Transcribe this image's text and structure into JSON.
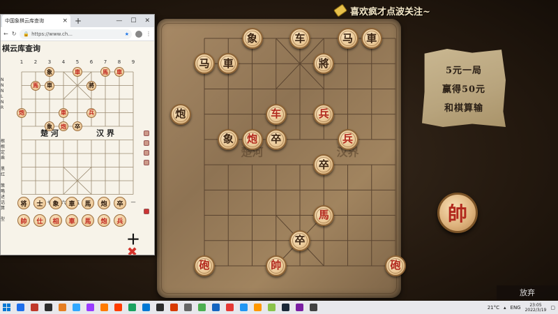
{
  "banner": {
    "text": "喜欢疯才点波关注~"
  },
  "note": {
    "lines": [
      "5元一局",
      "赢得50元",
      "和棋算输"
    ]
  },
  "shuai_big": "帥",
  "give_up_label": "放弃",
  "river": {
    "left": "楚河",
    "right": "汉界"
  },
  "main_pieces": [
    {
      "char": "象",
      "side": "black",
      "col": 2,
      "row": 0
    },
    {
      "char": "车",
      "side": "black",
      "col": 4,
      "row": 0
    },
    {
      "char": "马",
      "side": "black",
      "col": 6,
      "row": 0
    },
    {
      "char": "車",
      "side": "black",
      "col": 7,
      "row": 0
    },
    {
      "char": "马",
      "side": "black",
      "col": 0,
      "row": 1
    },
    {
      "char": "車",
      "side": "black",
      "col": 1,
      "row": 1
    },
    {
      "char": "將",
      "side": "black",
      "col": 5,
      "row": 1
    },
    {
      "char": "炮",
      "side": "black",
      "col": -1,
      "row": 3
    },
    {
      "char": "车",
      "side": "red",
      "col": 3,
      "row": 3
    },
    {
      "char": "兵",
      "side": "red",
      "col": 5,
      "row": 3
    },
    {
      "char": "象",
      "side": "black",
      "col": 1,
      "row": 4
    },
    {
      "char": "炮",
      "side": "red",
      "col": 2,
      "row": 4
    },
    {
      "char": "卒",
      "side": "black",
      "col": 3,
      "row": 4
    },
    {
      "char": "兵",
      "side": "red",
      "col": 6,
      "row": 4
    },
    {
      "char": "卒",
      "side": "black",
      "col": 5,
      "row": 5
    },
    {
      "char": "馬",
      "side": "red",
      "col": 5,
      "row": 7
    },
    {
      "char": "卒",
      "side": "black",
      "col": 4,
      "row": 8
    },
    {
      "char": "砲",
      "side": "red",
      "col": 0,
      "row": 9
    },
    {
      "char": "帥",
      "side": "red",
      "col": 3,
      "row": 9
    },
    {
      "char": "砲",
      "side": "red",
      "col": 8,
      "row": 9
    }
  ],
  "browser": {
    "tab_title": "中国象棋云库查询",
    "url": "https://www.ch...",
    "page_title": "棋云库查询",
    "col_nums_top": [
      "1",
      "2",
      "3",
      "4",
      "5",
      "6",
      "7",
      "8",
      "9"
    ],
    "col_nums_bottom": [
      "九",
      "八",
      "七",
      "六",
      "五",
      "四",
      "三",
      "二",
      "一"
    ],
    "side_labels": [
      "N",
      "N",
      "N",
      "L",
      "N",
      "R",
      "",
      "",
      "",
      "",
      "",
      "根",
      "根",
      "定",
      "乘",
      "",
      "黑",
      "红",
      "",
      "策略",
      "述",
      "话",
      "算",
      "",
      "型"
    ],
    "river": {
      "left": "楚 河",
      "right": "汉 界"
    },
    "mini_pieces": [
      {
        "char": "象",
        "side": "black",
        "col": 2,
        "row": 0
      },
      {
        "char": "車",
        "side": "red",
        "col": 4,
        "row": 0
      },
      {
        "char": "馬",
        "side": "red",
        "col": 6,
        "row": 0
      },
      {
        "char": "車",
        "side": "red",
        "col": 7,
        "row": 0
      },
      {
        "char": "馬",
        "side": "red",
        "col": 1,
        "row": 1
      },
      {
        "char": "車",
        "side": "black",
        "col": 2,
        "row": 1
      },
      {
        "char": "將",
        "side": "black",
        "col": 5,
        "row": 1
      },
      {
        "char": "炮",
        "side": "red",
        "col": 0,
        "row": 3
      },
      {
        "char": "車",
        "side": "red",
        "col": 3,
        "row": 3
      },
      {
        "char": "兵",
        "side": "red",
        "col": 5,
        "row": 3
      },
      {
        "char": "象",
        "side": "black",
        "col": 2,
        "row": 4
      },
      {
        "char": "炮",
        "side": "red",
        "col": 3,
        "row": 4
      },
      {
        "char": "卒",
        "side": "black",
        "col": 4,
        "row": 4
      }
    ],
    "tray_black": [
      "将",
      "士",
      "象",
      "車",
      "馬",
      "炮",
      "卒"
    ],
    "tray_red": [
      "帥",
      "仕",
      "相",
      "車",
      "馬",
      "炮",
      "兵"
    ]
  },
  "taskbar": {
    "lang": "ENG",
    "weather": "21°C",
    "time": "23:05",
    "date": "2022/3/19",
    "icon_colors": [
      "#1f6feb",
      "#c0392b",
      "#2c2c2c",
      "#e67e22",
      "#31a8ff",
      "#9a3cff",
      "#ff7b00",
      "#ff3d00",
      "#1aa260",
      "#0078d4",
      "#2c2c2c",
      "#d83b01",
      "#666666",
      "#4caf50",
      "#1565c0",
      "#e53935",
      "#2196f3",
      "#ff9800",
      "#8bc34a",
      "#1b2838",
      "#7b1fa2",
      "#424242"
    ]
  }
}
